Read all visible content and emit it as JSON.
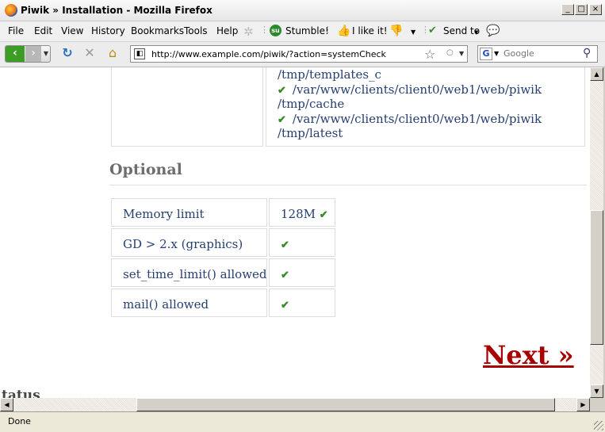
{
  "window": {
    "title": "Piwik » Installation - Mozilla Firefox",
    "minimize": "_",
    "maximize": "□",
    "close": "×"
  },
  "menubar": {
    "items": [
      "File",
      "Edit",
      "View",
      "History",
      "Bookmarks",
      "Tools",
      "Help"
    ],
    "stumble_label": "Stumble!",
    "ilike_label": "I like it!",
    "sendto_label": "Send to"
  },
  "navbar": {
    "url": "http://www.example.com/piwik/?action=systemCheck",
    "search_placeholder": "Google",
    "search_engine_letter": "G"
  },
  "content": {
    "writable_dirs": [
      "/tmp/templates_c",
      "/var/www/clients/client0/web1/web/piwik",
      "/tmp/cache",
      "/var/www/clients/client0/web1/web/piwik",
      "/tmp/latest"
    ],
    "optional_title": "Optional",
    "optional_rows": [
      {
        "label": "Memory limit",
        "value": "128M"
      },
      {
        "label": "GD > 2.x (graphics)",
        "value": ""
      },
      {
        "label": "set_time_limit() allowed",
        "value": ""
      },
      {
        "label": "mail() allowed",
        "value": ""
      }
    ],
    "next_label": "Next »",
    "cut_heading": "tatus"
  },
  "statusbar": {
    "text": "Done"
  }
}
